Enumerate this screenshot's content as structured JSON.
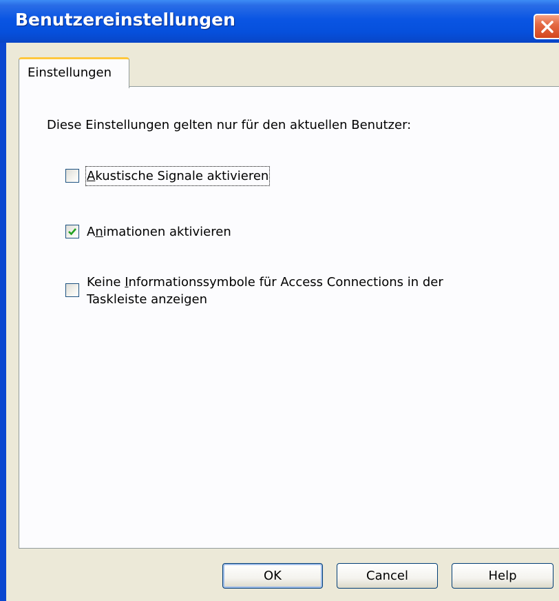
{
  "window": {
    "title": "Benutzereinstellungen"
  },
  "tabs": [
    {
      "label": "Einstellungen"
    }
  ],
  "panel": {
    "intro": "Diese Einstellungen gelten nur für den aktuellen Benutzer:",
    "options": [
      {
        "pre": "",
        "ul": "A",
        "post": "kustische Signale aktivieren",
        "checked": false
      },
      {
        "pre": "A",
        "ul": "n",
        "post": "imationen aktivieren",
        "checked": true
      },
      {
        "pre": "Keine ",
        "ul": "I",
        "post": "nformationssymbole für Access Connections in der",
        "line2": "Taskleiste anzeigen",
        "checked": false
      }
    ]
  },
  "buttons": {
    "ok": "OK",
    "cancel": "Cancel",
    "help": "Help"
  },
  "colors": {
    "titlebar": "#0a55e3",
    "dialog_bg": "#ece9d8",
    "tab_highlight": "#ffc73c",
    "check": "#21a121"
  }
}
